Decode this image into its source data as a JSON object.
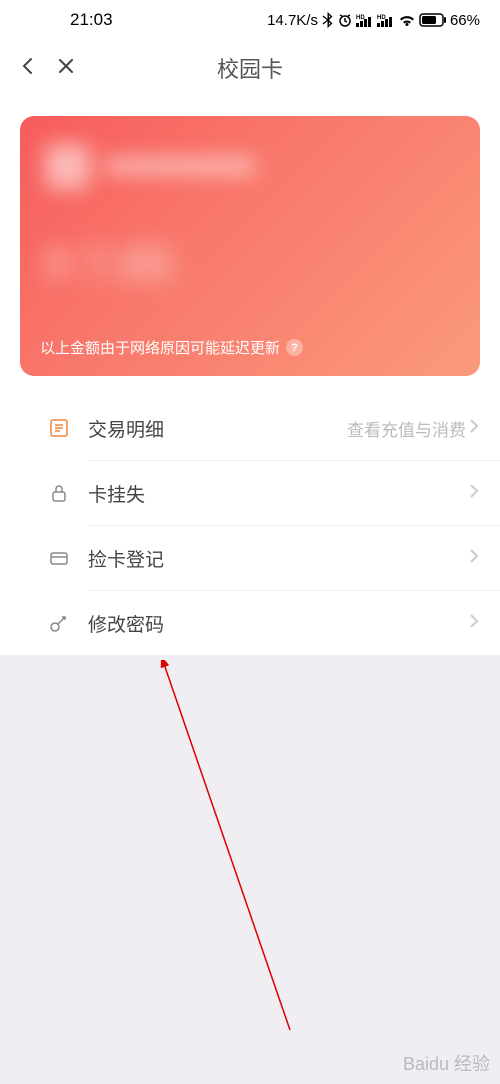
{
  "status": {
    "time": "21:03",
    "speed": "14.7K/s",
    "battery": "66%"
  },
  "nav": {
    "title": "校园卡"
  },
  "card": {
    "blur_amount": "¥ 7.85",
    "footer_text": "以上金额由于网络原因可能延迟更新",
    "help": "?"
  },
  "menu": {
    "items": [
      {
        "label": "交易明细",
        "sub": "查看充值与消费",
        "icon": "list"
      },
      {
        "label": "卡挂失",
        "sub": "",
        "icon": "lock"
      },
      {
        "label": "捡卡登记",
        "sub": "",
        "icon": "card"
      },
      {
        "label": "修改密码",
        "sub": "",
        "icon": "key"
      }
    ]
  },
  "watermark": {
    "text": "Baidu 经验"
  }
}
